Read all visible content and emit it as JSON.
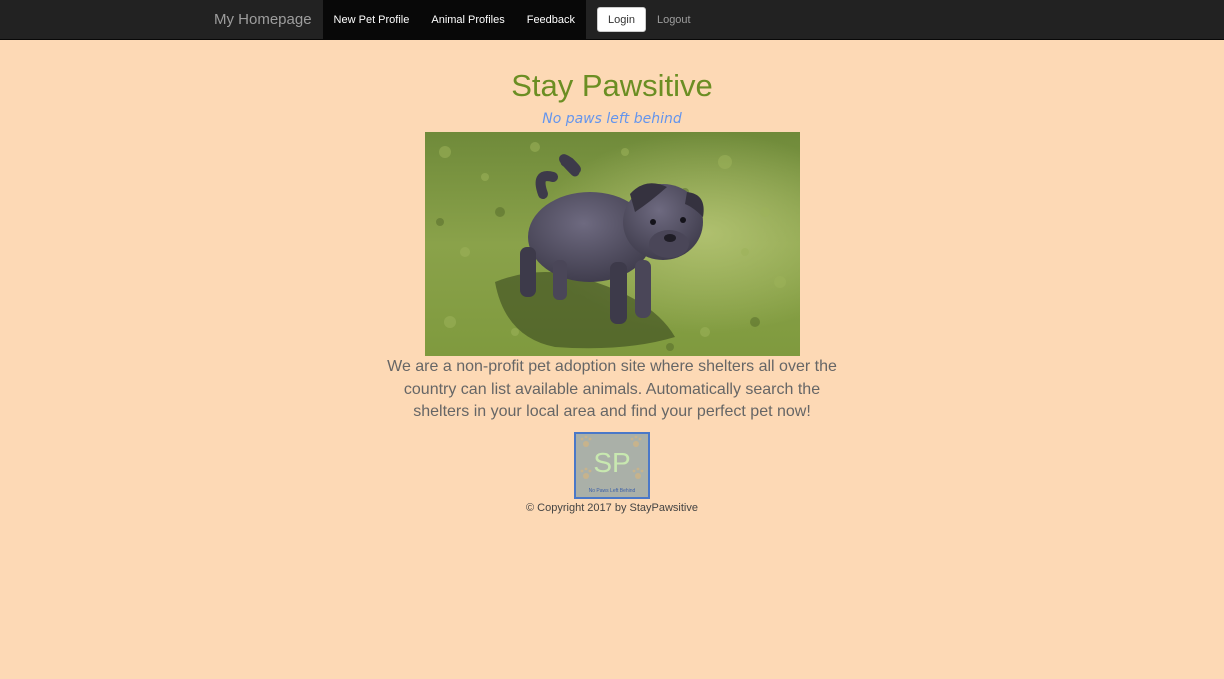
{
  "nav": {
    "brand": "My Homepage",
    "links": [
      "New Pet Profile",
      "Animal Profiles",
      "Feedback"
    ],
    "login_label": "Login",
    "logout_label": "Logout"
  },
  "hero": {
    "title": "Stay Pawsitive",
    "tagline": "No paws left behind",
    "image_alt": "puppy-on-grass"
  },
  "description": "We are a non-profit pet adoption site where shelters all over the country can list available animals. Automatically search the shelters in your local area and find your perfect pet now!",
  "logo": {
    "initials": "SP",
    "caption": "No Paws Left Behind"
  },
  "footer": {
    "copyright": "© Copyright 2017 by StayPawsitive"
  },
  "colors": {
    "page_background": "#fdd9b5",
    "navbar": "#222222",
    "title": "#6b8e23",
    "tagline": "#6495ed"
  }
}
